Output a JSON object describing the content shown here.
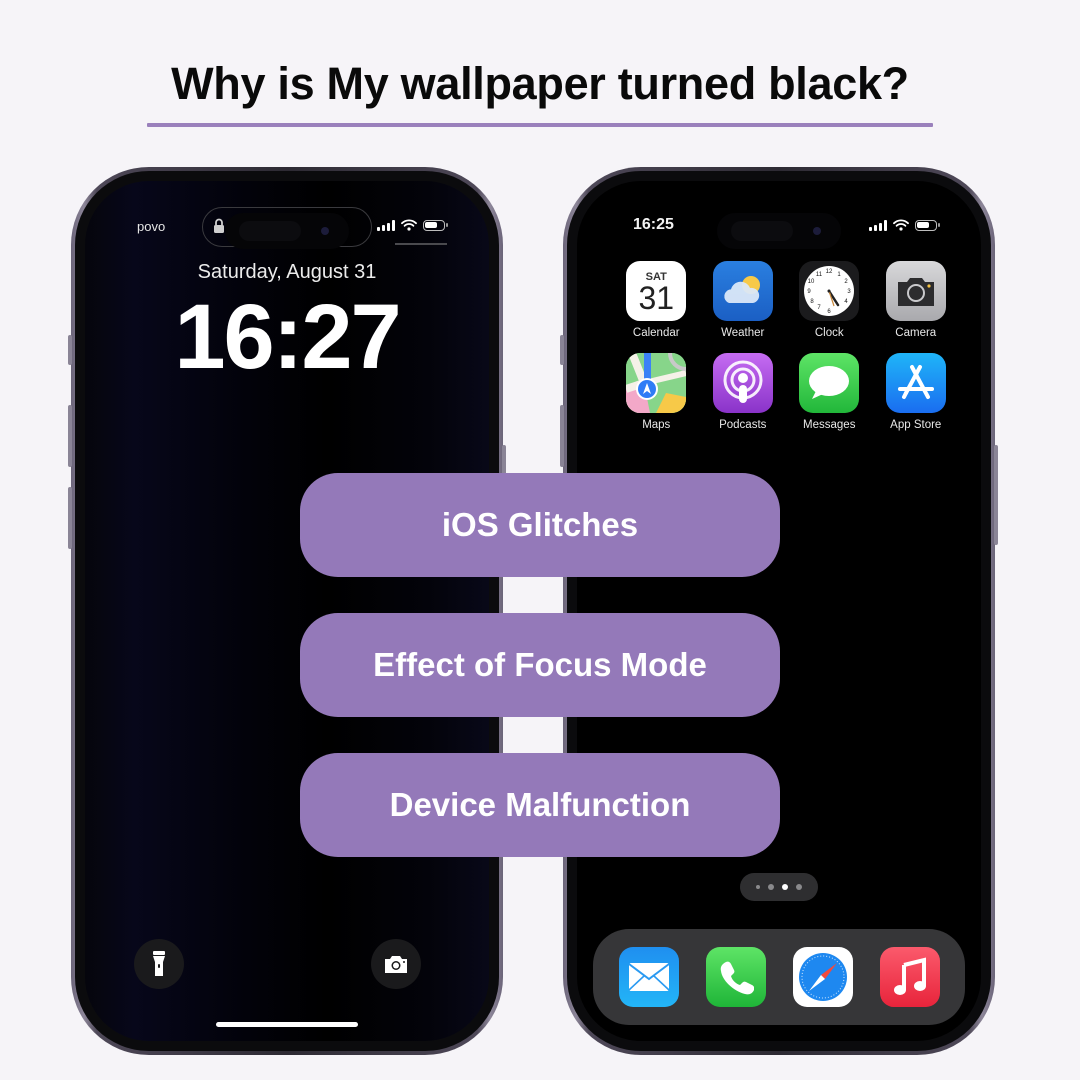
{
  "title": "Why is My wallpaper turned black?",
  "colors": {
    "accent": "#9479b9",
    "underline": "#9a80bc",
    "background": "#f6f4f8"
  },
  "lock_screen": {
    "carrier": "povo",
    "date": "Saturday, August 31",
    "time": "16:27",
    "status_icons": [
      "lock-icon",
      "signal-icon",
      "wifi-icon",
      "battery-icon"
    ],
    "buttons": [
      {
        "name": "flashlight",
        "icon": "flashlight-icon"
      },
      {
        "name": "camera",
        "icon": "camera-icon"
      }
    ]
  },
  "home_screen": {
    "status_time": "16:25",
    "status_icons": [
      "signal-icon",
      "wifi-icon",
      "battery-icon"
    ],
    "calendar": {
      "day": "SAT",
      "date": "31"
    },
    "apps": [
      {
        "label": "Calendar",
        "icon": "calendar-icon"
      },
      {
        "label": "Weather",
        "icon": "weather-icon"
      },
      {
        "label": "Clock",
        "icon": "clock-icon"
      },
      {
        "label": "Camera",
        "icon": "camera-icon"
      },
      {
        "label": "Maps",
        "icon": "maps-icon"
      },
      {
        "label": "Podcasts",
        "icon": "podcasts-icon"
      },
      {
        "label": "Messages",
        "icon": "messages-icon"
      },
      {
        "label": "App Store",
        "icon": "app-store-icon"
      }
    ],
    "page_indicator": {
      "pages": 4,
      "current": 3
    },
    "dock": [
      {
        "name": "Mail",
        "icon": "mail-icon"
      },
      {
        "name": "Phone",
        "icon": "phone-icon"
      },
      {
        "name": "Safari",
        "icon": "safari-icon"
      },
      {
        "name": "Music",
        "icon": "music-icon"
      }
    ]
  },
  "reasons": [
    "iOS Glitches",
    "Effect of Focus Mode",
    "Device Malfunction"
  ]
}
